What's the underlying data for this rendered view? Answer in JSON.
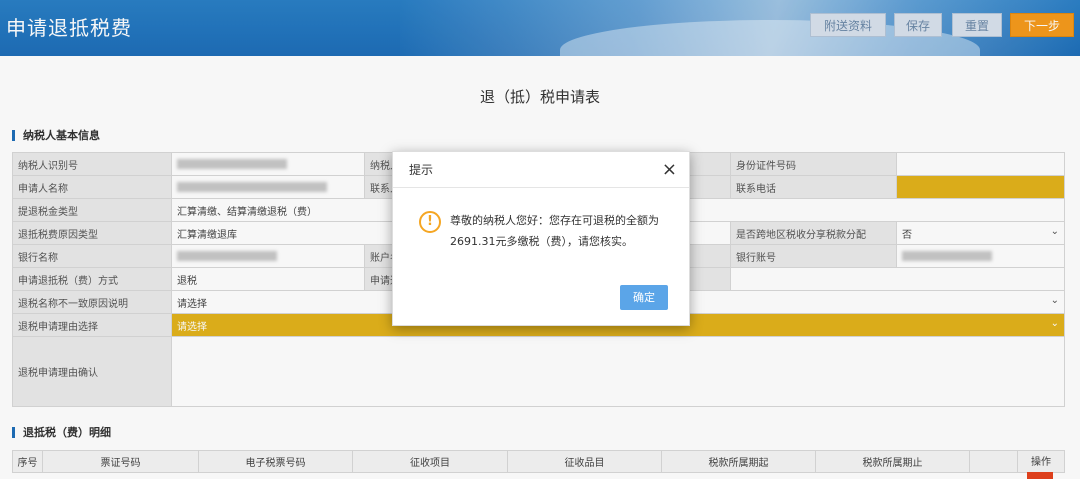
{
  "header": {
    "title": "申请退抵税费",
    "buttons": {
      "attach": "附送资料",
      "save": "保存",
      "reset": "重置",
      "next": "下一步"
    }
  },
  "form_title": "退（抵）税申请表",
  "section_basic": "纳税人基本信息",
  "section_detail": "退抵税（费）明细",
  "fields": {
    "taxpayer_id_label": "纳税人识别号",
    "taxpayer_name_label_partial": "纳税人",
    "id_type_label": "身份证件号码",
    "applicant_name_label": "申请人名称",
    "contact_label_partial": "联系人",
    "phone_label": "联系电话",
    "refund_type_label": "提退税金类型",
    "refund_type_value": "汇算清缴、结算清缴退税（费）",
    "reason_type_label": "退抵税费原因类型",
    "reason_type_value": "汇算清缴退库",
    "cross_region_label": "是否跨地区税收分享税款分配",
    "cross_region_value": "否",
    "bank_name_label": "银行名称",
    "account_label_partial": "账户名",
    "bank_account_label": "银行账号",
    "method_label": "申请退抵税（费）方式",
    "method_value": "退税",
    "apply_partial": "申请退",
    "mismatch_label": "退税名称不一致原因说明",
    "mismatch_value": "请选择",
    "reason_select_label": "退税申请理由选择",
    "reason_select_value": "请选择",
    "reason_confirm_label": "退税申请理由确认"
  },
  "detail_columns": [
    "序号",
    "票证号码",
    "电子税票号码",
    "征收项目",
    "征收品目",
    "税款所属期起",
    "税款所属期止",
    "操作"
  ],
  "modal": {
    "title": "提示",
    "close": "×",
    "message": "尊敬的纳税人您好：您存在可退税的全额为2691.31元多缴税（费），请您核实。",
    "ok": "确定"
  },
  "colors": {
    "header_blue": "#1e6eb8",
    "accent_orange": "#f59a1c",
    "highlight_yellow": "#e2b21b",
    "ok_blue": "#5ba5e8",
    "warn": "#f5a623"
  }
}
